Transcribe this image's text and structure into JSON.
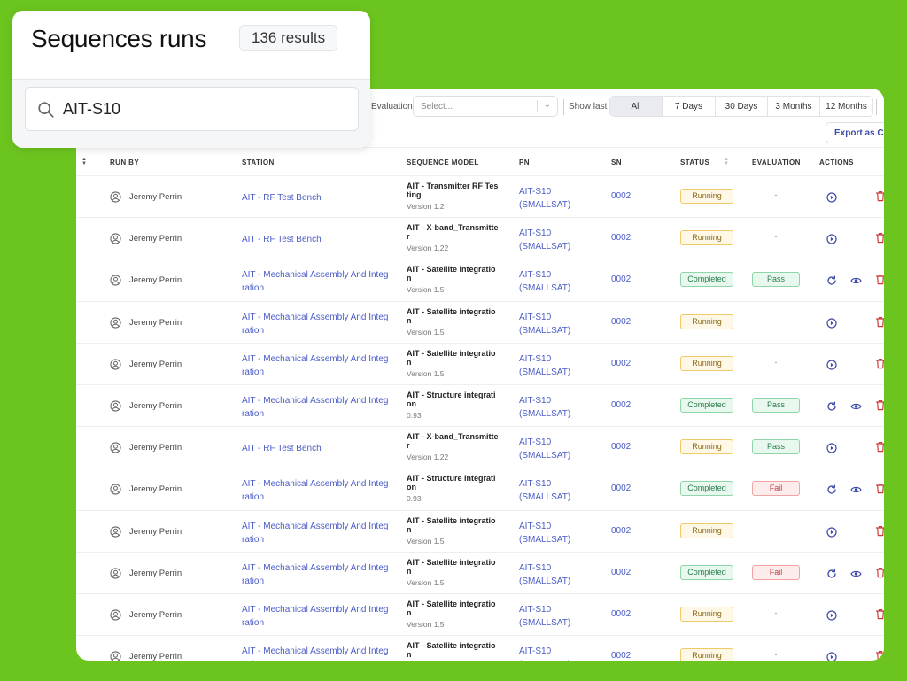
{
  "header": {
    "title": "Sequences runs",
    "result_count": "136 results"
  },
  "search": {
    "value": "AIT-S10"
  },
  "filters": {
    "evaluation_label": "Evaluation",
    "evaluation_placeholder": "Select...",
    "show_last_label": "Show last",
    "ranges": [
      "All",
      "7 Days",
      "30 Days",
      "3 Months",
      "12 Months"
    ],
    "selected_range": "All",
    "export_label": "Export as CSV"
  },
  "table": {
    "columns": [
      "RUN BY",
      "STATION",
      "SEQUENCE MODEL",
      "PN",
      "SN",
      "STATUS",
      "EVALUATION",
      "ACTIONS"
    ],
    "rows": [
      {
        "run_by": "Jeremy Perrin",
        "station": "AIT - RF Test Bench",
        "seq": "AIT - Transmitter RF Testing",
        "version": "Version 1.2",
        "pn": "AIT-S10 (SMALLSAT)",
        "sn": "0002",
        "status": "Running",
        "evaluation": "-"
      },
      {
        "run_by": "Jeremy Perrin",
        "station": "AIT - RF Test Bench",
        "seq": "AIT - X-band_Transmitter",
        "version": "Version 1.22",
        "pn": "AIT-S10 (SMALLSAT)",
        "sn": "0002",
        "status": "Running",
        "evaluation": "-"
      },
      {
        "run_by": "Jeremy Perrin",
        "station": "AIT - Mechanical Assembly And Integration",
        "seq": "AIT - Satellite integration",
        "version": "Version 1.5",
        "pn": "AIT-S10 (SMALLSAT)",
        "sn": "0002",
        "status": "Completed",
        "evaluation": "Pass"
      },
      {
        "run_by": "Jeremy Perrin",
        "station": "AIT - Mechanical Assembly And Integration",
        "seq": "AIT - Satellite integration",
        "version": "Version 1.5",
        "pn": "AIT-S10 (SMALLSAT)",
        "sn": "0002",
        "status": "Running",
        "evaluation": "-"
      },
      {
        "run_by": "Jeremy Perrin",
        "station": "AIT - Mechanical Assembly And Integration",
        "seq": "AIT - Satellite integration",
        "version": "Version 1.5",
        "pn": "AIT-S10 (SMALLSAT)",
        "sn": "0002",
        "status": "Running",
        "evaluation": "-"
      },
      {
        "run_by": "Jeremy Perrin",
        "station": "AIT - Mechanical Assembly And Integration",
        "seq": "AIT - Structure integration",
        "version": "0.93",
        "pn": "AIT-S10 (SMALLSAT)",
        "sn": "0002",
        "status": "Completed",
        "evaluation": "Pass"
      },
      {
        "run_by": "Jeremy Perrin",
        "station": "AIT - RF Test Bench",
        "seq": "AIT - X-band_Transmitter",
        "version": "Version 1.22",
        "pn": "AIT-S10 (SMALLSAT)",
        "sn": "0002",
        "status": "Running",
        "evaluation": "Pass"
      },
      {
        "run_by": "Jeremy Perrin",
        "station": "AIT - Mechanical Assembly And Integration",
        "seq": "AIT - Structure integration",
        "version": "0.93",
        "pn": "AIT-S10 (SMALLSAT)",
        "sn": "0002",
        "status": "Completed",
        "evaluation": "Fail"
      },
      {
        "run_by": "Jeremy Perrin",
        "station": "AIT - Mechanical Assembly And Integration",
        "seq": "AIT - Satellite integration",
        "version": "Version 1.5",
        "pn": "AIT-S10 (SMALLSAT)",
        "sn": "0002",
        "status": "Running",
        "evaluation": "-"
      },
      {
        "run_by": "Jeremy Perrin",
        "station": "AIT - Mechanical Assembly And Integration",
        "seq": "AIT - Satellite integration",
        "version": "Version 1.5",
        "pn": "AIT-S10 (SMALLSAT)",
        "sn": "0002",
        "status": "Completed",
        "evaluation": "Fail"
      },
      {
        "run_by": "Jeremy Perrin",
        "station": "AIT - Mechanical Assembly And Integration",
        "seq": "AIT - Satellite integration",
        "version": "Version 1.5",
        "pn": "AIT-S10 (SMALLSAT)",
        "sn": "0002",
        "status": "Running",
        "evaluation": "-"
      },
      {
        "run_by": "Jeremy Perrin",
        "station": "AIT - Mechanical Assembly And Integration",
        "seq": "AIT - Satellite integration",
        "version": "",
        "pn": "AIT-S10 (SMALLSAT)",
        "sn": "0002",
        "status": "Running",
        "evaluation": "-"
      }
    ]
  },
  "icons": {
    "user": "user-circle-icon",
    "play": "play-circle-icon",
    "retry": "refresh-icon",
    "view": "eye-icon",
    "delete": "trash-icon",
    "search": "search-icon",
    "sort": "sort-icon"
  },
  "colors": {
    "background": "#6cc51f",
    "link": "#4a5bc6",
    "running": "#f0c968",
    "completed": "#8ed5a8",
    "fail": "#f2a4a4",
    "delete": "#d03a3a"
  }
}
